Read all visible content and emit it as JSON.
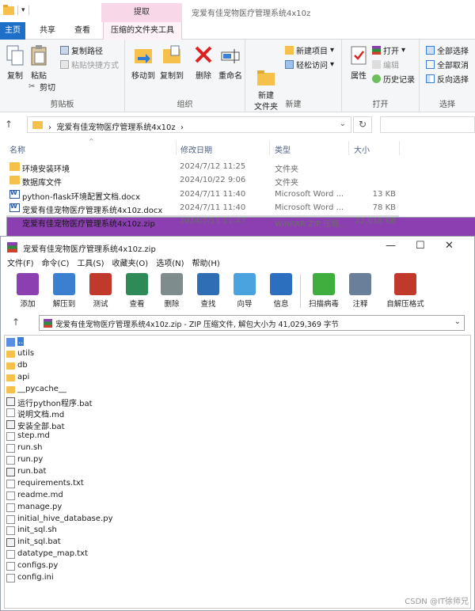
{
  "explorer": {
    "context_tab": "提取",
    "window_title": "宠爱有佳宠物医疗管理系统4x10z",
    "tabs": [
      "主页",
      "共享",
      "查看",
      "压缩的文件夹工具"
    ],
    "ribbon": {
      "clipboard": {
        "copy": "复制",
        "paste": "粘贴",
        "copy_path": "复制路径",
        "paste_shortcut": "粘贴快捷方式",
        "cut": "剪切",
        "label": "剪贴板"
      },
      "organize": {
        "move_to": "移动到",
        "copy_to": "复制到",
        "delete": "删除",
        "rename": "重命名",
        "label": "组织"
      },
      "new": {
        "new_folder": "新建\n文件夹",
        "new_item": "新建项目",
        "easy_access": "轻松访问",
        "label": "新建"
      },
      "open": {
        "properties": "属性",
        "open": "打开",
        "edit": "编辑",
        "history": "历史记录",
        "label": "打开"
      },
      "select": {
        "select_all": "全部选择",
        "select_none": "全部取消",
        "invert": "反向选择",
        "label": "选择"
      }
    },
    "address": "宠爱有佳宠物医疗管理系统4x10z",
    "columns": {
      "name": "名称",
      "date": "修改日期",
      "type": "类型",
      "size": "大小"
    },
    "files": [
      {
        "name": "环境安装环境",
        "date": "2024/7/12 11:25",
        "type": "文件夹",
        "size": "",
        "icon": "folder"
      },
      {
        "name": "数据库文件",
        "date": "2024/10/22 9:06",
        "type": "文件夹",
        "size": "",
        "icon": "folder"
      },
      {
        "name": "python-flask环境配置文档.docx",
        "date": "2024/7/11 11:40",
        "type": "Microsoft Word ...",
        "size": "13 KB",
        "icon": "word"
      },
      {
        "name": "宠爱有佳宠物医疗管理系统4x10z.docx",
        "date": "2024/7/11 11:40",
        "type": "Microsoft Word ...",
        "size": "78 KB",
        "icon": "word"
      },
      {
        "name": "宠爱有佳宠物医疗管理系统4x10z.zip",
        "date": "2024/7/11 11:47",
        "type": "WinRAR ZIP 压缩...",
        "size": "22,618 KB",
        "icon": "rar"
      }
    ]
  },
  "winrar": {
    "title": "宠爱有佳宠物医疗管理系统4x10z.zip",
    "menu": [
      "文件(F)",
      "命令(C)",
      "工具(S)",
      "收藏夹(O)",
      "选项(N)",
      "帮助(H)"
    ],
    "toolbar": [
      {
        "label": "添加",
        "color": "#8b3fb0"
      },
      {
        "label": "解压到",
        "color": "#3b7fd0"
      },
      {
        "label": "测试",
        "color": "#c0392b"
      },
      {
        "label": "查看",
        "color": "#2e8b57"
      },
      {
        "label": "删除",
        "color": "#7f8c8d"
      },
      {
        "label": "查找",
        "color": "#2f6db5"
      },
      {
        "label": "向导",
        "color": "#4aa3df"
      },
      {
        "label": "信息",
        "color": "#2c6fbf"
      },
      {
        "label": "扫描病毒",
        "color": "#3fae3f"
      },
      {
        "label": "注释",
        "color": "#6a7f9a"
      },
      {
        "label": "自解压格式",
        "color": "#c0392b"
      }
    ],
    "address": "宠爱有佳宠物医疗管理系统4x10z.zip - ZIP 压缩文件, 解包大小为 41,029,369 字节",
    "items": [
      {
        "name": "..",
        "icon": "up"
      },
      {
        "name": "utils",
        "icon": "folder"
      },
      {
        "name": "db",
        "icon": "folder"
      },
      {
        "name": "api",
        "icon": "folder"
      },
      {
        "name": "__pycache__",
        "icon": "folder"
      },
      {
        "name": "运行python程序.bat",
        "icon": "bat"
      },
      {
        "name": "说明文档.md",
        "icon": "file"
      },
      {
        "name": "安装全部.bat",
        "icon": "bat"
      },
      {
        "name": "step.md",
        "icon": "file"
      },
      {
        "name": "run.sh",
        "icon": "file"
      },
      {
        "name": "run.py",
        "icon": "file"
      },
      {
        "name": "run.bat",
        "icon": "bat"
      },
      {
        "name": "requirements.txt",
        "icon": "file"
      },
      {
        "name": "readme.md",
        "icon": "file"
      },
      {
        "name": "manage.py",
        "icon": "file"
      },
      {
        "name": "initial_hive_database.py",
        "icon": "file"
      },
      {
        "name": "init_sql.sh",
        "icon": "file"
      },
      {
        "name": "init_sql.bat",
        "icon": "bat"
      },
      {
        "name": "datatype_map.txt",
        "icon": "file"
      },
      {
        "name": "configs.py",
        "icon": "file"
      },
      {
        "name": "config.ini",
        "icon": "file"
      }
    ]
  },
  "watermark": "CSDN @IT徐师兄"
}
